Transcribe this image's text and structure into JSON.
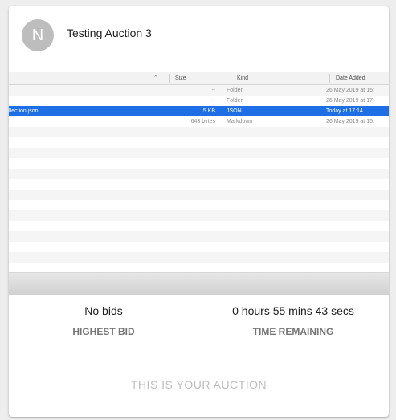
{
  "card": {
    "avatar_letter": "N",
    "title": "Testing Auction 3"
  },
  "screenshot": {
    "columns": {
      "size": "Size",
      "kind": "Kind",
      "date_added": "Date Added"
    },
    "sort_icon": "chevron-up-icon",
    "rows": [
      {
        "name": "",
        "size": "--",
        "kind": "Folder",
        "date_added": "26 May 2019 at 15:",
        "selected": false
      },
      {
        "name": "",
        "size": "--",
        "kind": "Folder",
        "date_added": "26 May 2019 at 17:",
        "selected": false
      },
      {
        "name": "llection.json",
        "size": "5 KB",
        "kind": "JSON",
        "date_added": "Today at 17:14",
        "selected": true
      },
      {
        "name": "",
        "size": "643 bytes",
        "kind": "Markdown",
        "date_added": "26 May 2019 at 15:",
        "selected": false
      }
    ],
    "empty_rows": 14,
    "selection_color": "#1e6ee6"
  },
  "stats": {
    "highest_bid_value": "No bids",
    "highest_bid_label": "HIGHEST BID",
    "time_remaining_value": "0 hours 55 mins 43 secs",
    "time_remaining_label": "TIME REMAINING"
  },
  "action": {
    "label": "THIS IS YOUR AUCTION"
  }
}
